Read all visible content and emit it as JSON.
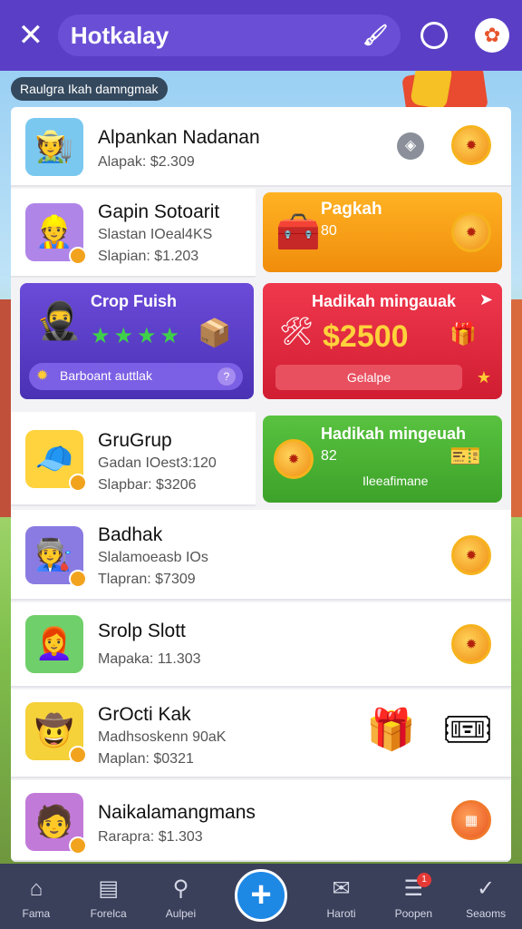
{
  "header": {
    "close_icon": "close-icon",
    "title": "Hotkalay",
    "brush_icon": "brush-icon",
    "search_icon": "search-icon",
    "profile_icon": "profile-icon"
  },
  "chip": "Raulgra Ikah damngmak",
  "rows": [
    {
      "name": "Alpankan Nadanan",
      "sub": "Alapak: $2.309"
    },
    {
      "name": "Gapin Sotoarit",
      "sub1": "Slastan IOeal4KS",
      "sub2": "Slapian: $1.203"
    },
    {
      "name": "GruGrup",
      "sub1": "Gadan IOest3:120",
      "sub2": "Slapbar: $3206"
    },
    {
      "name": "Badhak",
      "sub1": "Slalamoeasb IOs",
      "sub2": "Tlapran: $7309"
    },
    {
      "name": "Srolp Slott",
      "sub": "Mapaka: 11.303"
    },
    {
      "name": "GrOcti Kak",
      "sub1": "Madhsoskenn 90aK",
      "sub2": "Maplan: $0321"
    },
    {
      "name": "Naikalamangmans",
      "sub": "Rarapra: $1.303"
    }
  ],
  "cards": {
    "orange": {
      "title": "Pagkah",
      "value": "80"
    },
    "purple": {
      "title": "Crop Fuish",
      "footer": "Barboant auttlak"
    },
    "red": {
      "title": "Hadikah mingauak",
      "value": "$2500",
      "button": "Gelalpe"
    },
    "green": {
      "title": "Hadikah mingeuah",
      "value": "82",
      "footer": "Ileeafimane"
    }
  },
  "bottom_nav": [
    {
      "label": "Fama",
      "icon": "home-icon"
    },
    {
      "label": "Forelca",
      "icon": "store-icon"
    },
    {
      "label": "Aulpei",
      "icon": "search-icon"
    },
    {
      "label": "Haroti",
      "icon": "chat-icon"
    },
    {
      "label": "Poopen",
      "icon": "news-icon"
    },
    {
      "label": "Seaoms",
      "icon": "check-icon"
    }
  ],
  "nav_badge": "1",
  "fab_label": "+"
}
